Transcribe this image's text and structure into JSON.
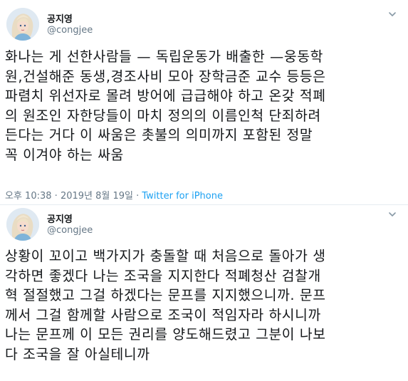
{
  "tweets": [
    {
      "author_name": "공지영",
      "author_handle": "@congjee",
      "text": "화나는 게 선한사람들 — 독립운동가 배출한 —웅동학\n원,건설해준 동생,경조사비 모아 장학금준 교수 등등은\n파렴치 위선자로 몰려 방어에 급급해야 하고 온갖 적폐\n의 원조인 자한당들이 마치 정의의 이름인척 단죄하려\n든다는 거다 이 싸움은 촛불의 의미까지 포함된 정말\n꼭 이겨야 하는 싸움",
      "time": "오후 10:38",
      "date": "2019년 8월 19일",
      "source": "Twitter for iPhone"
    },
    {
      "author_name": "공지영",
      "author_handle": "@congjee",
      "text": "상황이 꼬이고 백가지가 충돌할 때 처음으로 돌아가 생\n각하면 좋겠다 나는 조국을 지지한다 적폐청산 검찰개\n혁 절절했고 그걸 하겠다는 문프를 지지했으니까. 문프\n께서 그걸 함께할 사람으로 조국이 적임자라 하시니까\n나는 문프께 이 모든 권리를 양도해드렸고 그분이 나보\n다 조국을 잘 아실테니까"
    }
  ],
  "meta_separator": " · ",
  "colors": {
    "text": "#14171a",
    "secondary": "#657786",
    "link": "#1da1f2",
    "divider": "#e6ecf0"
  }
}
